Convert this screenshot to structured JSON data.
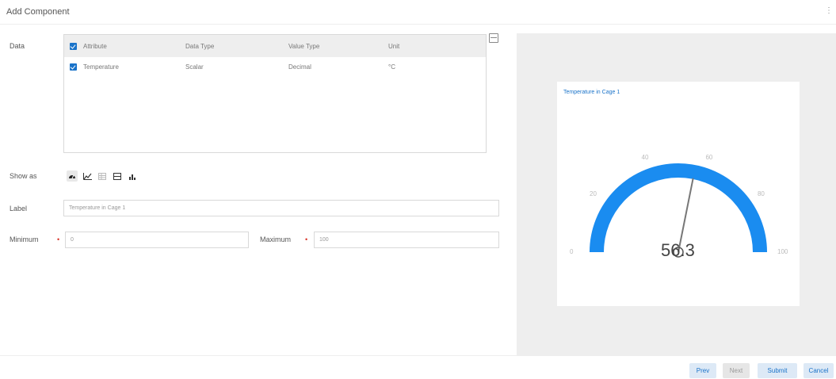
{
  "header": {
    "title": "Add Component",
    "menu_glyph": "⋮"
  },
  "form": {
    "data_label": "Data",
    "table": {
      "columns": [
        "Attribute",
        "Data Type",
        "Value Type",
        "Unit"
      ],
      "rows": [
        {
          "attribute": "Temperature",
          "data_type": "Scalar",
          "value_type": "Decimal",
          "unit": "°C"
        }
      ]
    },
    "show_as_label": "Show as",
    "show_as_options": [
      "gauge-icon",
      "line-chart-icon",
      "table-icon",
      "card-icon",
      "bar-icon"
    ],
    "label_label": "Label",
    "label_value": "Temperature in Cage 1",
    "minimum_label": "Minimum",
    "minimum_value": "0",
    "maximum_label": "Maximum",
    "maximum_value": "100"
  },
  "preview": {
    "title": "Temperature in Cage 1",
    "gauge": {
      "min": 0,
      "max": 100,
      "value": 56.3,
      "value_text": "56.3",
      "tick_labels": [
        "0",
        "20",
        "40",
        "60",
        "80",
        "100"
      ],
      "color": "#1a8cf0"
    }
  },
  "footer": {
    "prev_label": "Prev",
    "next_label": "Next",
    "submit_label": "Submit",
    "cancel_label": "Cancel"
  }
}
